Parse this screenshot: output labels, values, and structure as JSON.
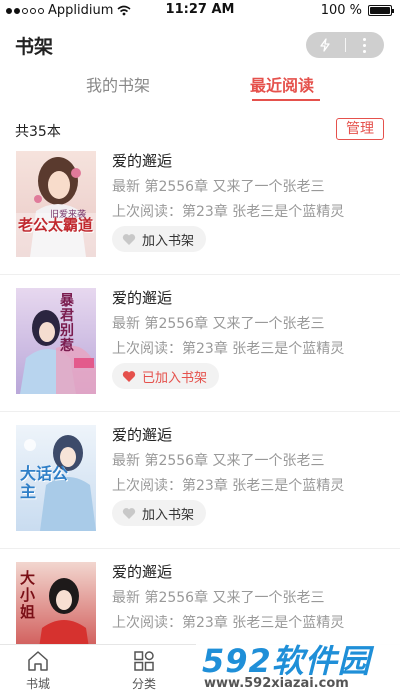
{
  "status_bar": {
    "carrier": "Applidium",
    "time": "11:27 AM",
    "battery": "100 %"
  },
  "header": {
    "title": "书架"
  },
  "tabs": [
    {
      "label": "我的书架",
      "active": false
    },
    {
      "label": "最近阅读",
      "active": true
    }
  ],
  "summary": {
    "count": "共35本",
    "manage_label": "管理"
  },
  "books": [
    {
      "title": "爱的邂逅",
      "latest": "最新 第2556章 又来了一个张老三",
      "last_read": "上次阅读：第23章 张老三是个蓝精灵",
      "shelf_label": "加入书架",
      "added": false
    },
    {
      "title": "爱的邂逅",
      "latest": "最新 第2556章 又来了一个张老三",
      "last_read": "上次阅读：第23章 张老三是个蓝精灵",
      "shelf_label": "已加入书架",
      "added": true
    },
    {
      "title": "爱的邂逅",
      "latest": "最新 第2556章 又来了一个张老三",
      "last_read": "上次阅读：第23章 张老三是个蓝精灵",
      "shelf_label": "加入书架",
      "added": false
    },
    {
      "title": "爱的邂逅",
      "latest": "最新 第2556章 又来了一个张老三",
      "last_read": "上次阅读：第23章 张老三是个蓝精灵"
    }
  ],
  "covers": [
    {
      "text_main": "老公太霸道",
      "text_sub": "旧爱来袭"
    },
    {
      "text_main": "暴君别惹"
    },
    {
      "text_main": "大话公主"
    },
    {
      "text_main": "大小姐"
    }
  ],
  "bottom_nav": [
    {
      "label": "书城",
      "icon": "home-icon"
    },
    {
      "label": "分类",
      "icon": "category-icon"
    }
  ],
  "watermark": {
    "logo": "592软件园",
    "url": "www.592xiazai.com"
  },
  "colors": {
    "accent": "#e5514c",
    "muted": "#999999",
    "watermark_blue": "#1f8fd8"
  }
}
